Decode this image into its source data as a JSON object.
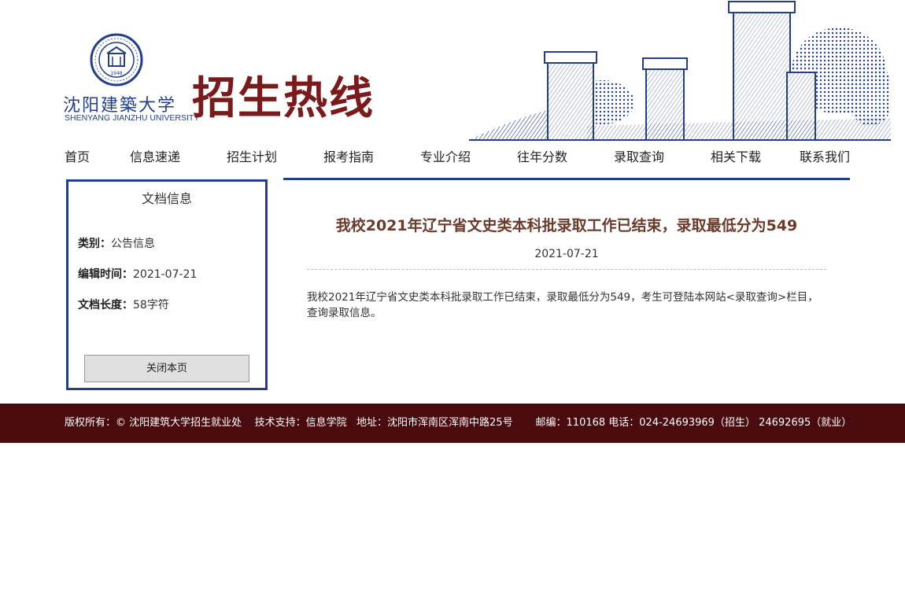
{
  "header": {
    "logo_cn": "沈阳建築大学",
    "logo_en": "SHENYANG JIANZHU UNIVERSITY",
    "seal_year": "1948",
    "site_title": "招生热线"
  },
  "nav": {
    "items": [
      "首页",
      "信息速递",
      "招生计划",
      "报考指南",
      "专业介绍",
      "往年分数",
      "录取查询",
      "相关下载",
      "联系我们"
    ]
  },
  "sidebar": {
    "title": "文档信息",
    "category_label": "类别：",
    "category_value": "公告信息",
    "edit_time_label": "编辑时间：",
    "edit_time_value": "2021-07-21",
    "length_label": "文档长度：",
    "length_value": "58字符",
    "close_button": "关闭本页"
  },
  "article": {
    "title": "我校2021年辽宁省文史类本科批录取工作已结束，录取最低分为549",
    "date": "2021-07-21",
    "body": "我校2021年辽宁省文史类本科批录取工作已结束，录取最低分为549，考生可登陆本网站<录取查询>栏目，查询录取信息。"
  },
  "footer": {
    "text": "版权所有：© 沈阳建筑大学招生就业处    技术支持：信息学院   地址：沈阳市浑南区浑南中路25号       邮编：110168 电话：024-24693969（招生） 24692695（就业）"
  },
  "colors": {
    "brand_red": "#7a1a1a",
    "brand_blue": "#233f8a",
    "footer_bg": "#4a0b0e"
  }
}
